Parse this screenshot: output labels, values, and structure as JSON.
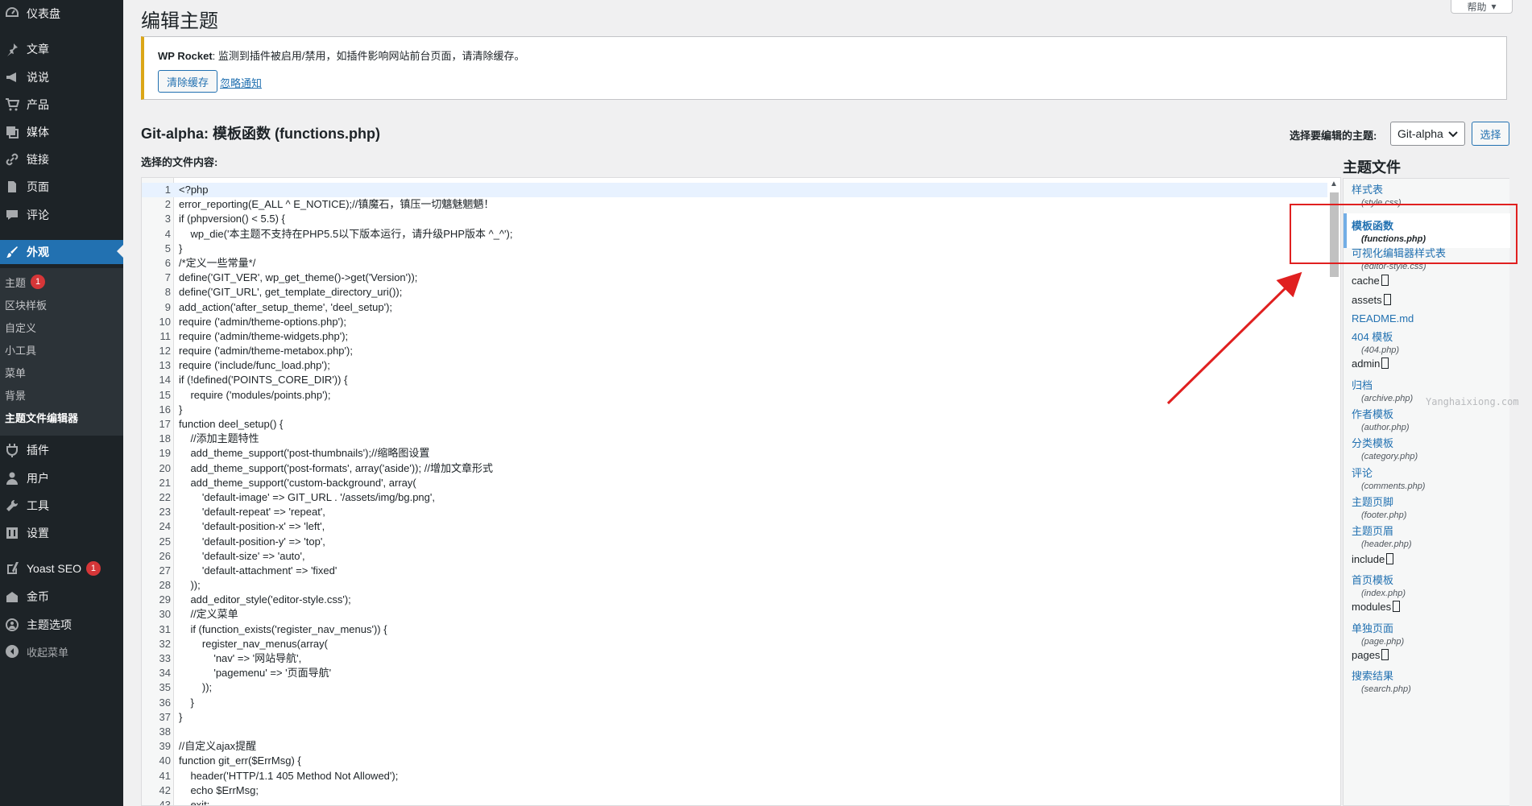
{
  "sidebar": {
    "items": [
      {
        "label": "仪表盘",
        "icon": "dashboard-icon"
      },
      {
        "label": "文章",
        "icon": "pin-icon"
      },
      {
        "label": "说说",
        "icon": "megaphone-icon"
      },
      {
        "label": "产品",
        "icon": "cart-icon"
      },
      {
        "label": "媒体",
        "icon": "media-icon"
      },
      {
        "label": "链接",
        "icon": "link-icon"
      },
      {
        "label": "页面",
        "icon": "page-icon"
      },
      {
        "label": "评论",
        "icon": "comment-icon"
      },
      {
        "label": "外观",
        "icon": "brush-icon"
      },
      {
        "label": "插件",
        "icon": "plugin-icon"
      },
      {
        "label": "用户",
        "icon": "user-icon"
      },
      {
        "label": "工具",
        "icon": "wrench-icon"
      },
      {
        "label": "设置",
        "icon": "settings-icon"
      },
      {
        "label": "Yoast SEO",
        "icon": "yoast-icon",
        "badge": "1"
      },
      {
        "label": "金币",
        "icon": "coin-icon"
      },
      {
        "label": "主题选项",
        "icon": "theme-options-icon"
      }
    ],
    "submenu": [
      {
        "label": "主题",
        "badge": "1"
      },
      {
        "label": "区块样板"
      },
      {
        "label": "自定义"
      },
      {
        "label": "小工具"
      },
      {
        "label": "菜单"
      },
      {
        "label": "背景"
      },
      {
        "label": "主题文件编辑器"
      }
    ],
    "collapse_label": "收起菜单"
  },
  "header": {
    "title": "编辑主题",
    "help_label": "帮助"
  },
  "notice": {
    "title": "WP Rocket",
    "message": ": 监测到插件被启用/禁用，如插件影响网站前台页面，请清除缓存。",
    "clear_button": "清除缓存",
    "dismiss_link": "忽略通知"
  },
  "editor": {
    "file_title": "Git-alpha: 模板函数 (functions.php)",
    "select_label": "选择要编辑的主题:",
    "theme_selected": "Git-alpha",
    "select_button": "选择",
    "content_label": "选择的文件内容:",
    "lines": [
      "<?php",
      "error_reporting(E_ALL ^ E_NOTICE);//镇魔石，镇压一切魑魅魍魉！",
      "if (phpversion() < 5.5) {",
      "    wp_die('本主题不支持在PHP5.5以下版本运行，请升级PHP版本 ^_^');",
      "}",
      "/*定义一些常量*/",
      "define('GIT_VER', wp_get_theme()->get('Version'));",
      "define('GIT_URL', get_template_directory_uri());",
      "add_action('after_setup_theme', 'deel_setup');",
      "require ('admin/theme-options.php');",
      "require ('admin/theme-widgets.php');",
      "require ('admin/theme-metabox.php');",
      "require ('include/func_load.php');",
      "if (!defined('POINTS_CORE_DIR')) {",
      "    require ('modules/points.php');",
      "}",
      "function deel_setup() {",
      "    //添加主题特性",
      "    add_theme_support('post-thumbnails');//缩略图设置",
      "    add_theme_support('post-formats', array('aside')); //增加文章形式",
      "    add_theme_support('custom-background', array(",
      "        'default-image' => GIT_URL . '/assets/img/bg.png',",
      "        'default-repeat' => 'repeat',",
      "        'default-position-x' => 'left',",
      "        'default-position-y' => 'top',",
      "        'default-size' => 'auto',",
      "        'default-attachment' => 'fixed'",
      "    ));",
      "    add_editor_style('editor-style.css');",
      "    //定义菜单",
      "    if (function_exists('register_nav_menus')) {",
      "        register_nav_menus(array(",
      "            'nav' => '网站导航',",
      "            'pagemenu' => '页面导航'",
      "        ));",
      "    }",
      "}",
      "",
      "//自定义ajax提醒",
      "function git_err($ErrMsg) {",
      "    header('HTTP/1.1 405 Method Not Allowed');",
      "    echo $ErrMsg;",
      "    exit;"
    ]
  },
  "files": {
    "heading": "主题文件",
    "items": [
      {
        "name": "样式表",
        "sub": "(style.css)",
        "type": "file"
      },
      {
        "name": "模板函数",
        "sub": "(functions.php)",
        "type": "file",
        "active": true
      },
      {
        "name": "可视化编辑器样式表",
        "sub": "(editor-style.css)",
        "type": "file"
      },
      {
        "name": "cache",
        "sub": "",
        "type": "dir"
      },
      {
        "name": "assets",
        "sub": "",
        "type": "dir"
      },
      {
        "name": "README.md",
        "sub": "",
        "type": "file"
      },
      {
        "name": "404 模板",
        "sub": "(404.php)",
        "type": "file"
      },
      {
        "name": "admin",
        "sub": "",
        "type": "dir"
      },
      {
        "name": "归档",
        "sub": "(archive.php)",
        "type": "file"
      },
      {
        "name": "作者模板",
        "sub": "(author.php)",
        "type": "file"
      },
      {
        "name": "分类模板",
        "sub": "(category.php)",
        "type": "file"
      },
      {
        "name": "评论",
        "sub": "(comments.php)",
        "type": "file"
      },
      {
        "name": "主题页脚",
        "sub": "(footer.php)",
        "type": "file"
      },
      {
        "name": "主题页眉",
        "sub": "(header.php)",
        "type": "file"
      },
      {
        "name": "include",
        "sub": "",
        "type": "dir"
      },
      {
        "name": "首页模板",
        "sub": "(index.php)",
        "type": "file"
      },
      {
        "name": "modules",
        "sub": "",
        "type": "dir"
      },
      {
        "name": "单独页面",
        "sub": "(page.php)",
        "type": "file"
      },
      {
        "name": "pages",
        "sub": "",
        "type": "dir"
      },
      {
        "name": "搜索结果",
        "sub": "(search.php)",
        "type": "file"
      }
    ]
  },
  "watermark": "Yanghaixiong.com",
  "colors": {
    "accent": "#2271b1",
    "sidebar": "#1d2327",
    "annotation": "#e02020",
    "notice_border": "#dba617"
  }
}
